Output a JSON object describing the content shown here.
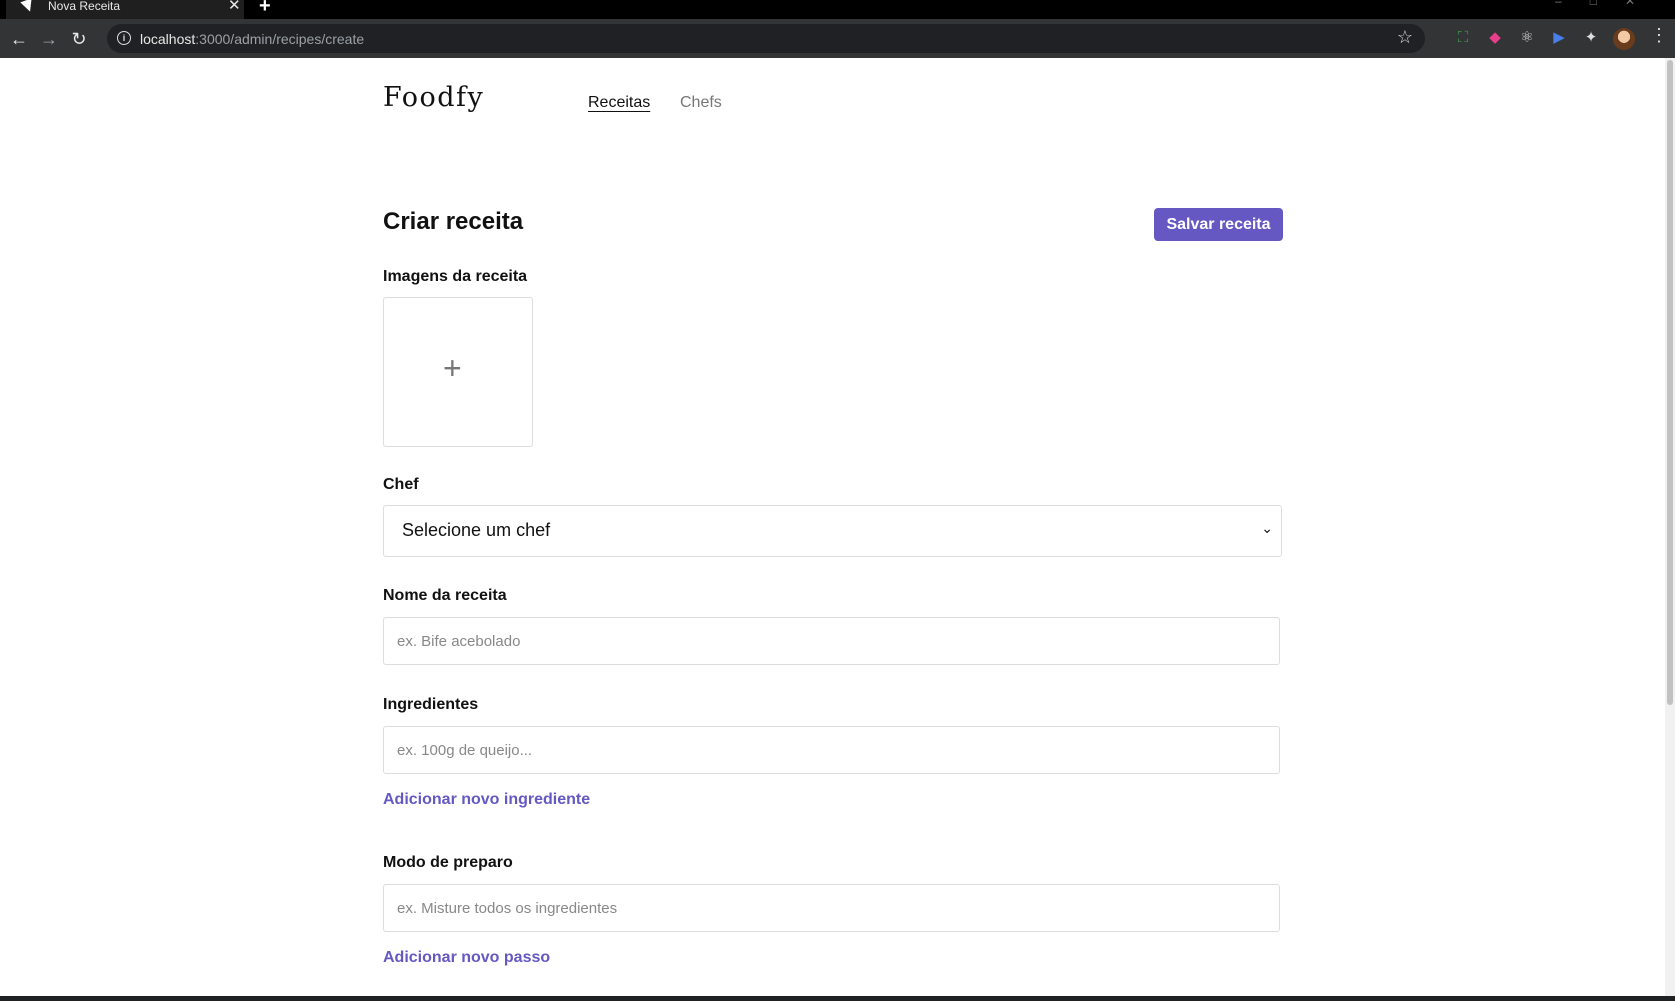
{
  "browser": {
    "tab_title": "Nova Receita",
    "tab_close": "✕",
    "new_tab": "+",
    "url_host": "localhost",
    "url_path": ":3000/admin/recipes/create"
  },
  "header": {
    "logo": "Foodfy",
    "nav": [
      {
        "label": "Receitas",
        "active": true
      },
      {
        "label": "Chefs",
        "active": false
      }
    ]
  },
  "form": {
    "title": "Criar receita",
    "save_label": "Salvar receita",
    "images_label": "Imagens da receita",
    "add_image_symbol": "+",
    "chef_label": "Chef",
    "chef_selected": "Selecione um chef",
    "name_label": "Nome da receita",
    "name_placeholder": "ex. Bife acebolado",
    "ingredients_label": "Ingredientes",
    "ingredients_placeholder": "ex. 100g de queijo...",
    "add_ingredient_label": "Adicionar novo ingrediente",
    "preparation_label": "Modo de preparo",
    "preparation_placeholder": "ex. Misture todos os ingredientes",
    "add_step_label": "Adicionar novo passo"
  },
  "colors": {
    "accent": "#6558c3",
    "chrome_dark": "#333436"
  }
}
